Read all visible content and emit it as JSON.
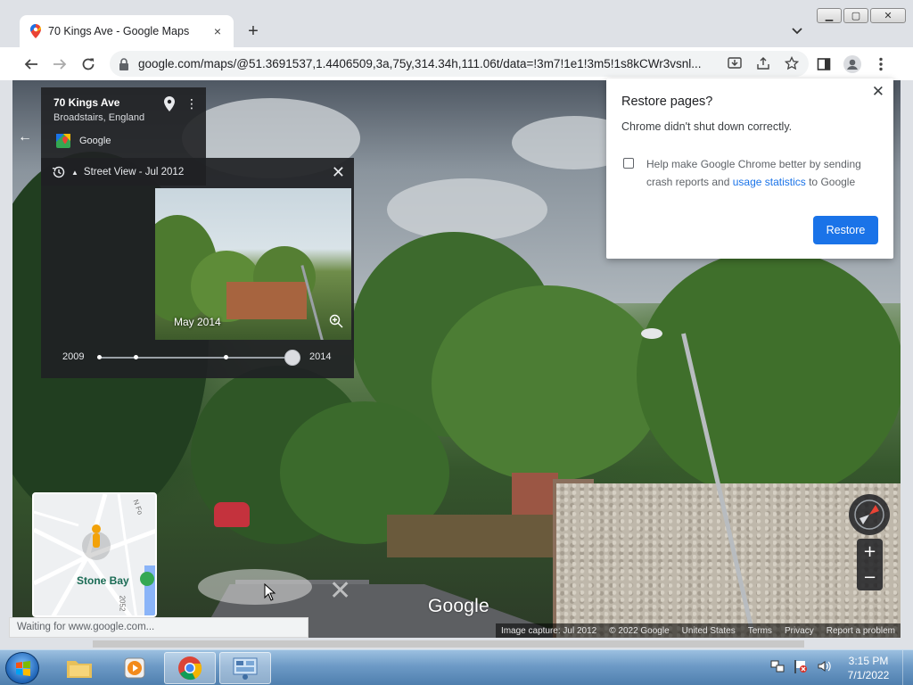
{
  "browser": {
    "tab_title": "70 Kings Ave - Google Maps",
    "tab_close": "×",
    "new_tab": "+",
    "url": "google.com/maps/@51.3691537,1.4406509,3a,75y,314.34h,111.06t/data=!3m7!1e1!3m5!1s8kCWr3vsnl...",
    "window_controls": [
      "minimize",
      "restore",
      "close"
    ]
  },
  "place_card": {
    "address": "70 Kings Ave",
    "locality": "Broadstairs, England",
    "provider": "Google"
  },
  "time_machine": {
    "header": "Street View - Jul 2012",
    "thumbnail_date": "May 2014",
    "start_year": "2009",
    "end_year": "2014",
    "selected_position": 1.0
  },
  "mini_map": {
    "place_label": "Stone Bay",
    "road_label_1": "N Fo",
    "road_label_2": "2052"
  },
  "street_view": {
    "watermark": "Google"
  },
  "footer": {
    "image_capture": "Image capture: Jul 2012",
    "copyright": "© 2022 Google",
    "country": "United States",
    "terms": "Terms",
    "privacy": "Privacy",
    "report": "Report a problem"
  },
  "status_bar": {
    "text": "Waiting for www.google.com..."
  },
  "restore_dialog": {
    "title": "Restore pages?",
    "subtitle": "Chrome didn't shut down correctly.",
    "checkbox_text_before": "Help make Google Chrome better by sending crash reports and ",
    "checkbox_link": "usage statistics",
    "checkbox_text_after": " to Google",
    "checkbox_checked": false,
    "button": "Restore"
  },
  "taskbar": {
    "time": "3:15 PM",
    "date": "7/1/2022"
  },
  "colors": {
    "accent": "#1a73e8",
    "panel_bg": "#202124",
    "taskbar": "#4f7fae"
  }
}
